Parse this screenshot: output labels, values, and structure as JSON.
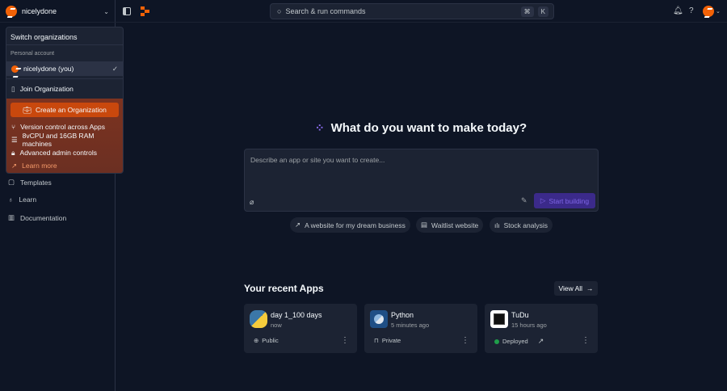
{
  "topbar": {
    "org_name": "nicelydone",
    "search_placeholder": "Search & run commands",
    "kbd_cmd": "⌘",
    "kbd_k": "K",
    "help": "?"
  },
  "org_menu": {
    "title": "Switch organizations",
    "section": "Personal account",
    "current": "nicelydone (you)",
    "check": "✓",
    "join": "Join Organization",
    "create": "Create an Organization",
    "features": [
      "Version control across Apps",
      "8vCPU and 16GB RAM machines",
      "Advanced admin controls"
    ],
    "learn_more": "Learn more"
  },
  "sidebar": {
    "items": [
      {
        "label": "Templates"
      },
      {
        "label": "Learn"
      },
      {
        "label": "Documentation"
      }
    ]
  },
  "main": {
    "heading": "What do you want to make today?",
    "prompt_placeholder": "Describe an app or site you want to create...",
    "start": "Start building",
    "suggestions": [
      "A website for my dream business",
      "Waitlist website",
      "Stock analysis"
    ],
    "recent_title": "Your recent Apps",
    "view_all": "View All",
    "apps": [
      {
        "name": "day 1_100 days",
        "time": "now",
        "visibility": "Public"
      },
      {
        "name": "Python",
        "time": "5 minutes ago",
        "visibility": "Private"
      },
      {
        "name": "TuDu",
        "time": "15 hours ago",
        "visibility": "Deployed"
      }
    ]
  },
  "colors": {
    "accent": "#f26207",
    "purple": "#5b3bd6",
    "bg": "#0e1525",
    "panel": "#1c2333"
  }
}
